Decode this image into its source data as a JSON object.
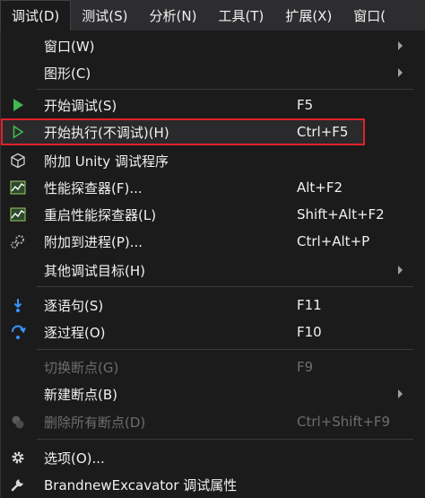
{
  "menubar": {
    "items": [
      {
        "label": "调试(D)"
      },
      {
        "label": "测试(S)"
      },
      {
        "label": "分析(N)"
      },
      {
        "label": "工具(T)"
      },
      {
        "label": "扩展(X)"
      },
      {
        "label": "窗口("
      }
    ]
  },
  "menu": {
    "window": {
      "label": "窗口(W)"
    },
    "graphics": {
      "label": "图形(C)"
    },
    "start_debugging": {
      "label": "开始调试(S)",
      "shortcut": "F5"
    },
    "start_without_debugging": {
      "label": "开始执行(不调试)(H)",
      "shortcut": "Ctrl+F5"
    },
    "attach_unity": {
      "label": "附加 Unity 调试程序"
    },
    "profiler": {
      "label": "性能探查器(F)...",
      "shortcut": "Alt+F2"
    },
    "relaunch_profiler": {
      "label": "重启性能探查器(L)",
      "shortcut": "Shift+Alt+F2"
    },
    "attach_process": {
      "label": "附加到进程(P)...",
      "shortcut": "Ctrl+Alt+P"
    },
    "other_targets": {
      "label": "其他调试目标(H)"
    },
    "step_into": {
      "label": "逐语句(S)",
      "shortcut": "F11"
    },
    "step_over": {
      "label": "逐过程(O)",
      "shortcut": "F10"
    },
    "toggle_breakpoint": {
      "label": "切换断点(G)",
      "shortcut": "F9"
    },
    "new_breakpoint": {
      "label": "新建断点(B)"
    },
    "delete_breakpoints": {
      "label": "删除所有断点(D)",
      "shortcut": "Ctrl+Shift+F9"
    },
    "options": {
      "label": "选项(O)..."
    },
    "project_properties": {
      "label": "BrandnewExcavator 调试属性"
    }
  },
  "colors": {
    "highlight_border": "#e0222b",
    "play_green": "#3fb950",
    "blue_accent": "#3794ff"
  }
}
